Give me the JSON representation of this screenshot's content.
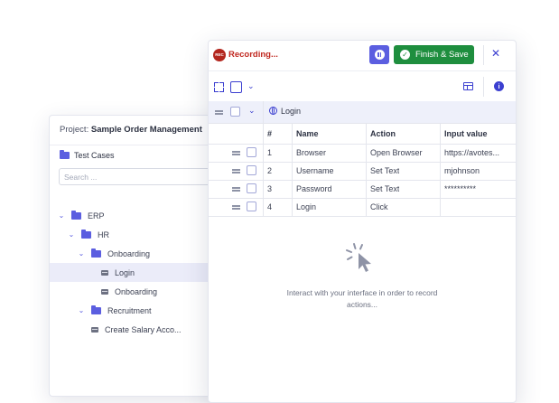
{
  "tree_panel": {
    "project_label": "Project:",
    "project_name": "Sample Order Management",
    "section_title": "Test Cases",
    "search_placeholder": "Search ...",
    "items": [
      {
        "label": "ERP",
        "kind": "folder",
        "expanded": true
      },
      {
        "label": "HR",
        "kind": "folder",
        "expanded": true
      },
      {
        "label": "Onboarding",
        "kind": "folder",
        "expanded": true
      },
      {
        "label": "Login",
        "kind": "test-case",
        "selected": true
      },
      {
        "label": "Onboarding",
        "kind": "test-case"
      },
      {
        "label": "Recruitment",
        "kind": "folder",
        "expanded": true
      },
      {
        "label": "Create Salary Acco...",
        "kind": "test-case"
      }
    ]
  },
  "recorder": {
    "rec_badge": "REC",
    "status": "Recording...",
    "finish_label": "Finish & Save",
    "close_label": "✕",
    "group_label": "Login",
    "columns": [
      "#",
      "Name",
      "Action",
      "Input value"
    ],
    "rows": [
      {
        "num": "1",
        "name": "Browser",
        "action": "Open Browser",
        "input": "https://avotes..."
      },
      {
        "num": "2",
        "name": "Username",
        "action": "Set Text",
        "input": "mjohnson"
      },
      {
        "num": "3",
        "name": "Password",
        "action": "Set Text",
        "input": "**********"
      },
      {
        "num": "4",
        "name": "Login",
        "action": "Click",
        "input": ""
      }
    ],
    "empty_message": "Interact with your interface in order to record actions..."
  },
  "colors": {
    "accent": "#5b5ee0",
    "primary_icon": "#3b3fd0",
    "success": "#1e8e3e",
    "recording": "#c0271f",
    "selected_bg": "#ebecf9"
  }
}
